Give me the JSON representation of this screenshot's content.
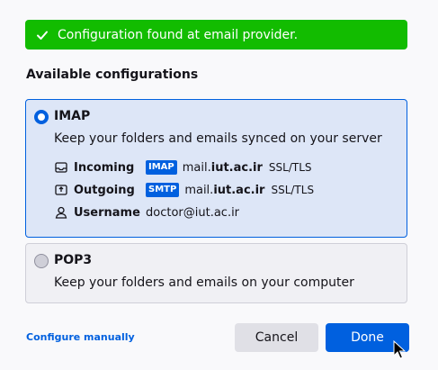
{
  "banner": {
    "text": "Configuration found at email provider."
  },
  "section_title": "Available configurations",
  "imap": {
    "protocol": "IMAP",
    "description": "Keep your folders and emails synced on your server",
    "incoming": {
      "label": "Incoming",
      "badge": "IMAP",
      "host_prefix": "mail.",
      "host_domain": "iut.ac.ir",
      "security": "SSL/TLS"
    },
    "outgoing": {
      "label": "Outgoing",
      "badge": "SMTP",
      "host_prefix": "mail.",
      "host_domain": "iut.ac.ir",
      "security": "SSL/TLS"
    },
    "username": {
      "label": "Username",
      "value": "doctor@iut.ac.ir"
    },
    "selected": true
  },
  "pop3": {
    "protocol": "POP3",
    "description": "Keep your folders and emails on your computer",
    "selected": false
  },
  "actions": {
    "configure_manually": "Configure manually",
    "cancel": "Cancel",
    "done": "Done"
  },
  "colors": {
    "success": "#12bc00",
    "accent": "#0060df"
  }
}
